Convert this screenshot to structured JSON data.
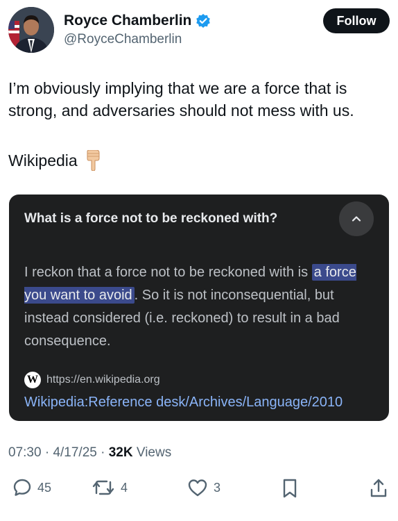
{
  "author": {
    "name": "Royce Chamberlin",
    "handle": "@RoyceChamberlin",
    "verified": true
  },
  "follow_label": "Follow",
  "tweet": {
    "text_line1": "I’m obviously implying that we are a force that is strong, and adversaries should not mess with us.",
    "text_line2": "Wikipedia",
    "emoji_icon": "backhand-pointing-down-icon"
  },
  "card": {
    "question": "What is a force not to be reckoned with?",
    "answer_before": "I reckon that a force not to be reckoned with is ",
    "answer_highlight": "a force you want to avoid",
    "answer_after": ". So it is not inconsequential, but instead considered (i.e. reckoned) to result in a bad consequence.",
    "source_url": "https://en.wikipedia.org",
    "source_title": "Wikipedia:Reference desk/Archives/Language/2010"
  },
  "meta": {
    "time": "07:30",
    "date": "4/17/25",
    "views_count": "32K",
    "views_label": "Views"
  },
  "actions": {
    "replies": "45",
    "reposts": "4",
    "likes": "3"
  },
  "colors": {
    "accent": "#1d9bf0",
    "card_bg": "#1e1f20",
    "highlight": "#3b4a8c",
    "link": "#8ab4f8"
  }
}
